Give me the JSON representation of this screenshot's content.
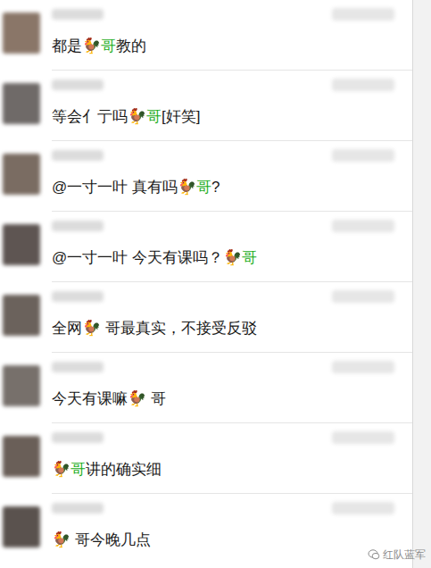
{
  "comments": [
    {
      "parts": [
        {
          "text": "都是",
          "highlight": false
        },
        {
          "text": "🐓",
          "highlight": false
        },
        {
          "text": "哥",
          "highlight": true
        },
        {
          "text": "教的",
          "highlight": false
        }
      ]
    },
    {
      "parts": [
        {
          "text": "等会亻亍吗",
          "highlight": false
        },
        {
          "text": "🐓",
          "highlight": false
        },
        {
          "text": "哥",
          "highlight": true
        },
        {
          "text": "[奸笑]",
          "highlight": false
        }
      ]
    },
    {
      "parts": [
        {
          "text": "@一寸一叶 真有吗",
          "highlight": false
        },
        {
          "text": "🐓",
          "highlight": false
        },
        {
          "text": "哥",
          "highlight": true
        },
        {
          "text": "?",
          "highlight": false
        }
      ]
    },
    {
      "parts": [
        {
          "text": "@一寸一叶 今天有课吗？",
          "highlight": false
        },
        {
          "text": "🐓",
          "highlight": false
        },
        {
          "text": "哥",
          "highlight": true
        }
      ]
    },
    {
      "parts": [
        {
          "text": "全网",
          "highlight": false
        },
        {
          "text": "🐓",
          "highlight": false
        },
        {
          "text": " 哥最真实，不接受反驳",
          "highlight": false
        }
      ]
    },
    {
      "parts": [
        {
          "text": "今天有课嘛",
          "highlight": false
        },
        {
          "text": "🐓",
          "highlight": false
        },
        {
          "text": " 哥",
          "highlight": false
        }
      ]
    },
    {
      "parts": [
        {
          "text": "🐓",
          "highlight": false
        },
        {
          "text": "哥",
          "highlight": true
        },
        {
          "text": "讲的确实细",
          "highlight": false
        }
      ]
    },
    {
      "parts": [
        {
          "text": "🐓",
          "highlight": false
        },
        {
          "text": " 哥今晚几点",
          "highlight": false
        }
      ]
    }
  ],
  "watermark": {
    "text": "红队蓝军"
  }
}
